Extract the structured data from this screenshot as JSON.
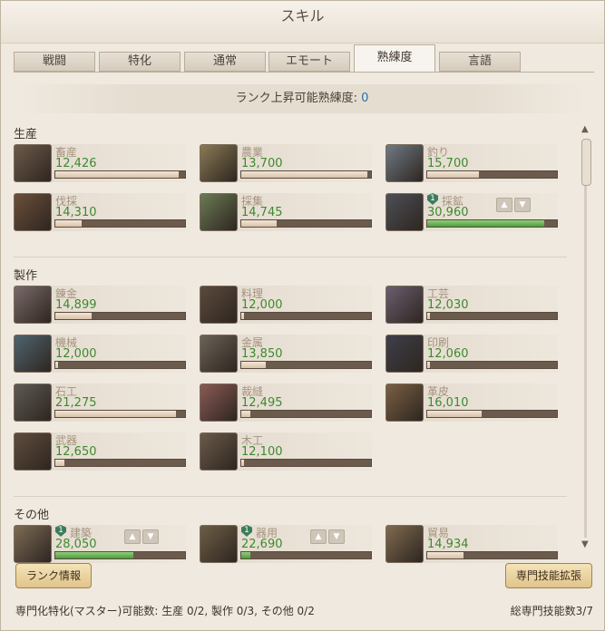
{
  "window": {
    "title": "スキル"
  },
  "tabs": [
    {
      "label": "戦闘",
      "active": false
    },
    {
      "label": "特化",
      "active": false
    },
    {
      "label": "通常",
      "active": false
    },
    {
      "label": "エモート",
      "active": false
    },
    {
      "label": "熟練度",
      "active": true
    },
    {
      "label": "言語",
      "active": false
    }
  ],
  "rank": {
    "label": "ランク上昇可能熟練度:",
    "value": "0"
  },
  "sections": [
    {
      "title": "生産",
      "items": [
        {
          "name": "畜産",
          "value": "12,426",
          "progress": 0.95,
          "icon": "livestock-icon",
          "badge": "",
          "arrows": false,
          "highlight": false
        },
        {
          "name": "農業",
          "value": "13,700",
          "progress": 0.97,
          "icon": "farming-icon",
          "badge": "",
          "arrows": false,
          "highlight": false
        },
        {
          "name": "釣り",
          "value": "15,700",
          "progress": 0.4,
          "icon": "fishing-icon",
          "badge": "",
          "arrows": false,
          "highlight": false
        },
        {
          "name": "伐採",
          "value": "14,310",
          "progress": 0.2,
          "icon": "logging-icon",
          "badge": "",
          "arrows": false,
          "highlight": false
        },
        {
          "name": "採集",
          "value": "14,745",
          "progress": 0.27,
          "icon": "gathering-icon",
          "badge": "",
          "arrows": false,
          "highlight": false
        },
        {
          "name": "採鉱",
          "value": "30,960",
          "progress": 0.9,
          "icon": "mining-icon",
          "badge": "1",
          "arrows": true,
          "highlight": true
        }
      ]
    },
    {
      "title": "製作",
      "items": [
        {
          "name": "錬金",
          "value": "14,899",
          "progress": 0.28,
          "icon": "alchemy-icon",
          "badge": "",
          "arrows": false,
          "highlight": false
        },
        {
          "name": "料理",
          "value": "12,000",
          "progress": 0.02,
          "icon": "cooking-icon",
          "badge": "",
          "arrows": false,
          "highlight": false
        },
        {
          "name": "工芸",
          "value": "12,030",
          "progress": 0.02,
          "icon": "handicraft-icon",
          "badge": "",
          "arrows": false,
          "highlight": false
        },
        {
          "name": "機械",
          "value": "12,000",
          "progress": 0.02,
          "icon": "machinery-icon",
          "badge": "",
          "arrows": false,
          "highlight": false
        },
        {
          "name": "金属",
          "value": "13,850",
          "progress": 0.19,
          "icon": "metalwork-icon",
          "badge": "",
          "arrows": false,
          "highlight": false
        },
        {
          "name": "印刷",
          "value": "12,060",
          "progress": 0.02,
          "icon": "printing-icon",
          "badge": "",
          "arrows": false,
          "highlight": false
        },
        {
          "name": "石工",
          "value": "21,275",
          "progress": 0.93,
          "icon": "masonry-icon",
          "badge": "",
          "arrows": false,
          "highlight": false
        },
        {
          "name": "裁縫",
          "value": "12,495",
          "progress": 0.07,
          "icon": "tailoring-icon",
          "badge": "",
          "arrows": false,
          "highlight": false
        },
        {
          "name": "革皮",
          "value": "16,010",
          "progress": 0.42,
          "icon": "leatherwork-icon",
          "badge": "",
          "arrows": false,
          "highlight": false
        },
        {
          "name": "武器",
          "value": "12,650",
          "progress": 0.07,
          "icon": "weaponry-icon",
          "badge": "",
          "arrows": false,
          "highlight": false
        },
        {
          "name": "木工",
          "value": "12,100",
          "progress": 0.02,
          "icon": "carpentry-icon",
          "badge": "",
          "arrows": false,
          "highlight": false
        }
      ]
    },
    {
      "title": "その他",
      "items": [
        {
          "name": "建築",
          "value": "28,050",
          "progress": 0.6,
          "icon": "construction-icon",
          "badge": "1",
          "arrows": true,
          "highlight": true
        },
        {
          "name": "器用",
          "value": "22,690",
          "progress": 0.07,
          "icon": "dexterity-icon",
          "badge": "1",
          "arrows": true,
          "highlight": true
        },
        {
          "name": "貿易",
          "value": "14,934",
          "progress": 0.28,
          "icon": "trade-icon",
          "badge": "",
          "arrows": false,
          "highlight": false
        }
      ]
    }
  ],
  "buttons": {
    "rank_info": "ランク情報",
    "expand": "専門技能拡張"
  },
  "footer": {
    "left": "専門化特化(マスター)可能数: 生産 0/2, 製作 0/3, その他 0/2",
    "right": "総専門技能数3/7"
  },
  "colors": {
    "value_green": "#3c8a2e",
    "bar_green": "#4e9b3e",
    "rank_blue": "#2f6fb0"
  }
}
